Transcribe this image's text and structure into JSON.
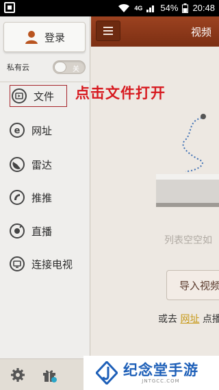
{
  "status_bar": {
    "sim_label": "4G",
    "battery": "54%",
    "time": "20:48"
  },
  "sidebar": {
    "login_label": "登录",
    "private_cloud_label": "私有云",
    "toggle_label": "关",
    "items": [
      {
        "label": "文件",
        "icon": "folder-play-icon"
      },
      {
        "label": "网址",
        "icon": "browser-e-icon"
      },
      {
        "label": "雷达",
        "icon": "radar-icon"
      },
      {
        "label": "推推",
        "icon": "push-icon"
      },
      {
        "label": "直播",
        "icon": "live-icon"
      },
      {
        "label": "连接电视",
        "icon": "tv-icon"
      }
    ],
    "bottom_icons": [
      "settings-gear-icon",
      "gift-icon"
    ]
  },
  "annotation": "点击文件打开",
  "main": {
    "title": "视频",
    "empty_text": "列表空空如",
    "import_button": "导入视频",
    "goto_prefix": "或去",
    "goto_link": "网址",
    "goto_suffix": "点播"
  },
  "watermark": {
    "main": "纪念堂手游",
    "sub": "JNTGCC.COM"
  },
  "colors": {
    "accent": "#8a3517",
    "annotation": "#d7191f",
    "link": "#c79a1b"
  }
}
